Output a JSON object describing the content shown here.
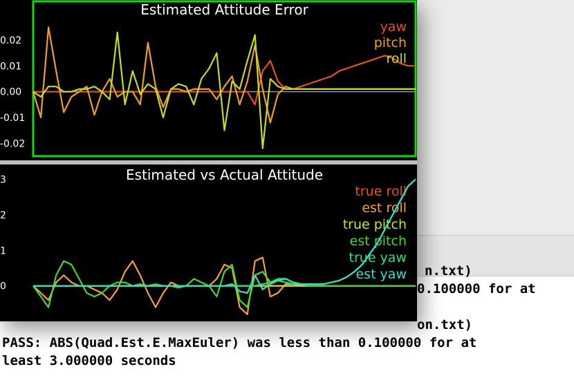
{
  "terminal": {
    "line_top_partial": "n.txt)",
    "line_value_partial": "0.100000 for at",
    "line_path_partial": "on.txt)",
    "line_pass": "PASS: ABS(Quad.Est.E.MaxEuler) was less than 0.100000 for at",
    "line_seconds": "least 3.000000 seconds"
  },
  "colors": {
    "yaw": "#e8501c",
    "pitch": "#f0a020",
    "roll": "#c8dc18",
    "true_roll": "#f04a14",
    "est_roll": "#f8a030",
    "true_pitch": "#c8e818",
    "est_pitch": "#40d830",
    "true_yaw": "#28e078",
    "est_yaw": "#30e0c8",
    "frame": "#14d814"
  },
  "chart_data": [
    {
      "type": "line",
      "title": "Estimated Attitude Error",
      "yticks": [
        "0.02",
        "0.01",
        "0.00",
        "-0.01",
        "-0.02"
      ],
      "ylim": [
        -0.025,
        0.035
      ],
      "x": [
        0,
        0.2,
        0.4,
        0.6,
        0.8,
        1.0,
        1.2,
        1.4,
        1.6,
        1.8,
        2.0,
        2.2,
        2.4,
        2.6,
        2.8,
        3.0,
        3.2,
        3.4,
        3.6,
        3.8,
        4.0,
        4.2,
        4.4,
        4.6,
        4.8,
        5.0,
        5.2,
        5.4,
        5.6,
        5.8,
        6.0,
        6.2,
        6.4,
        6.6,
        6.8,
        7.0,
        7.2,
        7.4,
        7.6,
        7.8,
        8.0,
        8.2,
        8.4,
        8.6,
        8.8,
        9.0,
        9.2,
        9.4,
        9.6,
        9.8,
        10.0
      ],
      "series": [
        {
          "name": "yaw",
          "values": [
            0,
            0,
            0,
            0,
            0,
            0,
            0,
            0,
            0,
            0,
            0,
            0,
            0,
            0,
            0,
            0,
            0,
            0,
            0,
            0,
            0,
            0,
            0,
            0,
            0,
            0,
            0,
            0,
            0,
            -0.005,
            0.008,
            0.012,
            0.004,
            0.001,
            0.001,
            0.002,
            0.003,
            0.004,
            0.005,
            0.006,
            0.008,
            0.009,
            0.01,
            0.011,
            0.012,
            0.013,
            0.014,
            0.013,
            0.011,
            0.01,
            0.01
          ]
        },
        {
          "name": "pitch",
          "values": [
            0,
            -0.01,
            0.025,
            0.008,
            -0.008,
            -0.002,
            0,
            0.002,
            -0.009,
            0,
            0.005,
            -0.002,
            0,
            0,
            -0.005,
            0.019,
            0.002,
            -0.006,
            0.001,
            0.001,
            0,
            0.001,
            0.001,
            0.001,
            -0.003,
            0.002,
            0.006,
            -0.005,
            0.004,
            0.018,
            0.001,
            -0.012,
            -0.001,
            0.002,
            0.001,
            0.001,
            0.001,
            0.001,
            0.001,
            0.001,
            0.001,
            0.001,
            0.001,
            0.001,
            0.001,
            0.001,
            0.001,
            0.001,
            0.001,
            0.001,
            0.001
          ]
        },
        {
          "name": "roll",
          "values": [
            0,
            -0.002,
            0.002,
            0.002,
            0,
            0,
            0.001,
            0.001,
            0.002,
            0,
            -0.003,
            0.023,
            -0.005,
            0.008,
            -0.001,
            0.003,
            0.001,
            -0.01,
            0.001,
            0.003,
            0.002,
            -0.005,
            0.005,
            0.009,
            0.015,
            -0.015,
            0.004,
            0.001,
            0.012,
            0.022,
            -0.022,
            0.005,
            0.002,
            0.001,
            0.001,
            0.001,
            0.001,
            0.001,
            0.001,
            0.001,
            0.001,
            0.001,
            0.001,
            0.001,
            0.001,
            0.001,
            0.001,
            0.001,
            0.001,
            0.001,
            0.001
          ]
        }
      ]
    },
    {
      "type": "line",
      "title": "Estimated vs Actual Attitude",
      "yticks": [
        "3",
        "2",
        "1",
        "0"
      ],
      "ylim": [
        -0.9,
        3.3
      ],
      "x": [
        0,
        0.2,
        0.4,
        0.6,
        0.8,
        1.0,
        1.2,
        1.4,
        1.6,
        1.8,
        2.0,
        2.2,
        2.4,
        2.6,
        2.8,
        3.0,
        3.2,
        3.4,
        3.6,
        3.8,
        4.0,
        4.2,
        4.4,
        4.6,
        4.8,
        5.0,
        5.2,
        5.4,
        5.6,
        5.8,
        6.0,
        6.2,
        6.4,
        6.6,
        6.8,
        7.0,
        7.2,
        7.4,
        7.6,
        7.8,
        8.0,
        8.2,
        8.4,
        8.6,
        8.8,
        9.0,
        9.2,
        9.4,
        9.6,
        9.8,
        10.0
      ],
      "series": [
        {
          "name": "true roll",
          "values": [
            0,
            0,
            0,
            0,
            0,
            0,
            0,
            0,
            0,
            0,
            0,
            0,
            0,
            0,
            0,
            0,
            0,
            0,
            0,
            0,
            0,
            0,
            0,
            0,
            0,
            0,
            0,
            0,
            0,
            0,
            0,
            0,
            0,
            0,
            0,
            0,
            0,
            0,
            0,
            0,
            0,
            0,
            0,
            0,
            0,
            0,
            0,
            0,
            0,
            0,
            0
          ]
        },
        {
          "name": "est roll",
          "values": [
            0,
            -0.2,
            -0.4,
            0.1,
            0.3,
            0.1,
            0,
            0,
            -0.1,
            -0.2,
            -0.4,
            -0.1,
            0.4,
            0.7,
            0.3,
            -0.2,
            -0.6,
            -0.2,
            0.1,
            0,
            0,
            0,
            0,
            0,
            0.2,
            0.6,
            0.5,
            -0.6,
            -0.8,
            0.7,
            0.8,
            -0.3,
            -0.2,
            0.05,
            0.05,
            0,
            0,
            0,
            0,
            0,
            0,
            0,
            0,
            0,
            0,
            0,
            0,
            0,
            0,
            0,
            0
          ]
        },
        {
          "name": "true pitch",
          "values": [
            0,
            0,
            0,
            0,
            0,
            0,
            0,
            0,
            0,
            0,
            0,
            0,
            0,
            0,
            0,
            0,
            0,
            0,
            0,
            0,
            0,
            0,
            0,
            0,
            0,
            0,
            0,
            0,
            0,
            0,
            0,
            0,
            0,
            0,
            0,
            0,
            0,
            0,
            0,
            0,
            0,
            0,
            0,
            0,
            0,
            0,
            0,
            0,
            0,
            0,
            0
          ]
        },
        {
          "name": "est pitch",
          "values": [
            0,
            -0.3,
            -0.6,
            0.3,
            0.7,
            0.6,
            0.2,
            -0.2,
            -0.3,
            -0.2,
            0,
            0.1,
            0.1,
            0,
            0.05,
            0,
            0.05,
            0,
            0,
            -0.05,
            0,
            0.2,
            0.1,
            0,
            -0.3,
            0.4,
            0.6,
            -0.4,
            -0.6,
            0.3,
            0.4,
            0.1,
            0.2,
            0.2,
            0.1,
            0.05,
            0,
            0,
            0,
            0,
            0,
            0,
            0,
            0,
            0,
            0,
            0,
            0,
            0,
            0,
            0
          ]
        },
        {
          "name": "true yaw",
          "values": [
            0,
            0,
            0,
            0,
            0,
            0,
            0,
            0,
            0,
            0,
            0,
            0,
            0,
            0,
            0,
            0,
            0,
            0,
            0,
            0,
            0,
            0,
            0,
            0,
            0,
            0,
            0,
            0,
            0,
            0,
            0.05,
            0.1,
            0.15,
            0.1,
            0.05,
            0.05,
            0.05,
            0.05,
            0.05,
            0.1,
            0.15,
            0.25,
            0.4,
            0.6,
            0.9,
            1.2,
            1.6,
            2.0,
            2.4,
            2.8,
            3.0
          ]
        },
        {
          "name": "est yaw",
          "values": [
            0,
            0,
            0,
            0,
            0,
            0,
            0,
            0,
            0,
            0,
            0,
            0,
            0,
            0,
            0,
            0,
            0,
            0,
            0,
            0,
            0,
            0,
            0,
            0,
            0,
            0,
            0.05,
            -0.15,
            -0.2,
            0.3,
            -0.1,
            0.05,
            0.15,
            0.2,
            0.1,
            0.05,
            0.05,
            0.05,
            0.05,
            0.1,
            0.15,
            0.25,
            0.4,
            0.6,
            0.9,
            1.2,
            1.6,
            2.0,
            2.4,
            2.8,
            3.0
          ]
        }
      ]
    }
  ]
}
